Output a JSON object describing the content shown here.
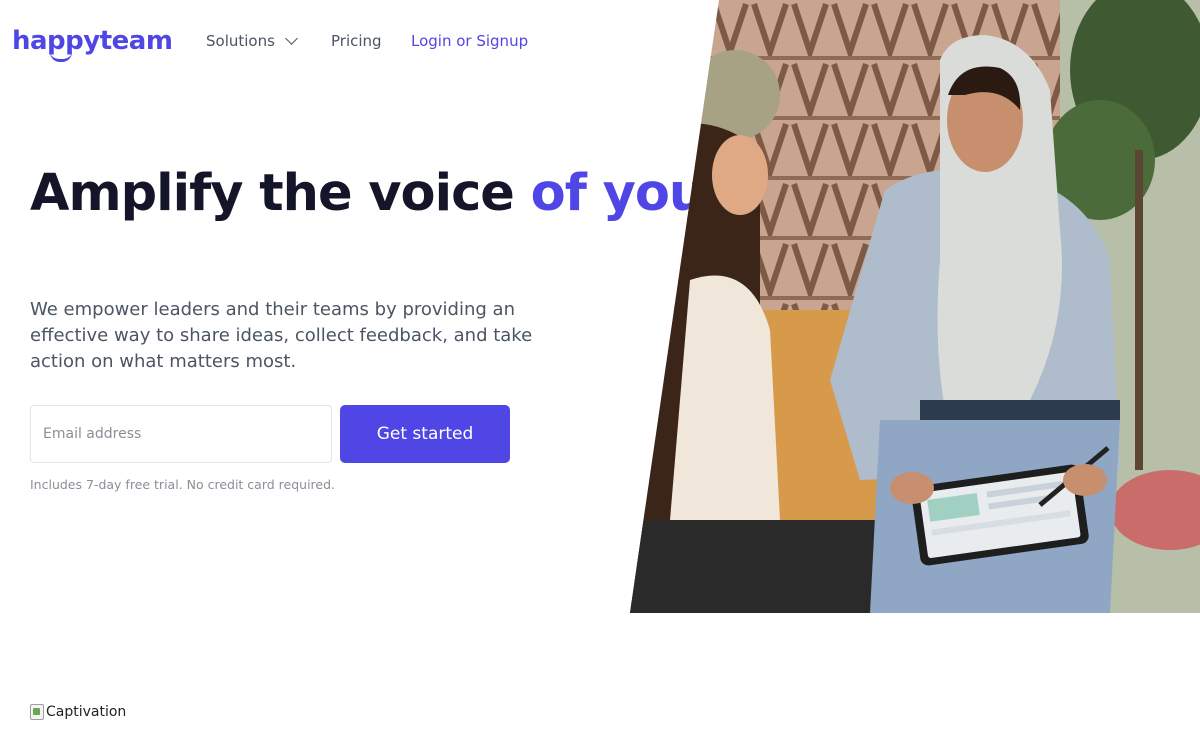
{
  "header": {
    "logo_text": "happyteam",
    "nav": {
      "solutions_label": "Solutions",
      "pricing_label": "Pricing",
      "login_label": "Login or Signup"
    }
  },
  "hero": {
    "headline_part1": "Amplify the voice ",
    "headline_accent": "of your organization",
    "subtext": "We empower leaders and their teams by providing an effective way to share ideas, collect feedback, and take action on what matters most.",
    "email_placeholder": "Email address",
    "cta_label": "Get started",
    "trial_note": "Includes 7-day free trial. No credit card required."
  },
  "below": {
    "image_alt": "Captivation"
  },
  "colors": {
    "brand": "#4f46e5",
    "heading": "#15152a",
    "body_text": "#4b5563",
    "muted": "#8a8f98"
  },
  "icons": [
    "chevron-down-icon",
    "broken-image-icon"
  ]
}
